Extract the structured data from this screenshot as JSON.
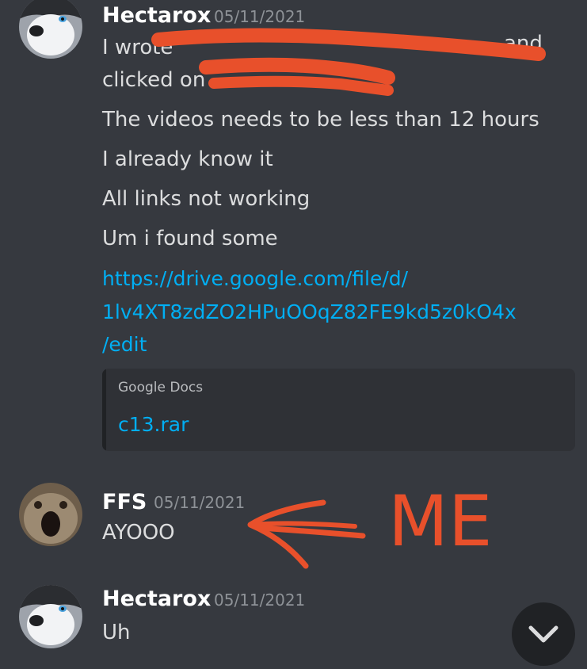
{
  "colors": {
    "background": "#36393f",
    "text": "#dcddde",
    "author": "#ffffff",
    "timestamp": "#8e9297",
    "link": "#00aff4",
    "embed_bg": "#2f3136",
    "annotation": "#e8502b"
  },
  "messages": [
    {
      "author": "Hectarox",
      "timestamp": "05/11/2021",
      "avatar_icon": "husky-avatar",
      "lines": [
        "I wrote",
        "clicked on",
        "The videos needs to be less than 12 hours",
        "I already know it",
        "All links not working",
        "Um i found some"
      ],
      "redacted_fragment": "and",
      "link_lines": [
        "https://drive.google.com/file/d/",
        "1lv4XT8zdZO2HPuOOqZ82FE9kd5z0kO4x",
        "/edit"
      ],
      "embed": {
        "provider": "Google Docs",
        "title": "c13.rar"
      }
    },
    {
      "author": "FFS",
      "timestamp": "05/11/2021",
      "avatar_icon": "cat-avatar",
      "lines": [
        "AYOOO"
      ],
      "annotation": "ME"
    },
    {
      "author": "Hectarox",
      "timestamp": "05/11/2021",
      "avatar_icon": "husky-avatar",
      "lines": [
        "Uh"
      ]
    }
  ],
  "scroll_button_icon": "chevron-down-icon"
}
